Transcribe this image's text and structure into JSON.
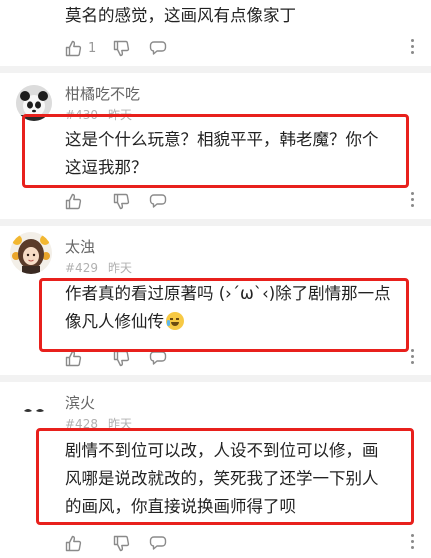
{
  "comments": [
    {
      "lines": [
        "莫名的感觉，这画风有点像家丁"
      ],
      "like_count": "1"
    },
    {
      "username": "柑橘吃不吃",
      "floor": "#430",
      "time": "昨天",
      "lines": [
        "这是个什么玩意？相貌平平，韩老魔？你个",
        "这逗我那？"
      ]
    },
    {
      "username": "太浊",
      "floor": "#429",
      "time": "昨天",
      "lines": [
        "作者真的看过原著吗 (›´ω`‹)除了剧情那一点",
        "像凡人修仙传"
      ]
    },
    {
      "username": "滨火",
      "floor": "#428",
      "time": "昨天",
      "lines": [
        "剧情不到位可以改，人设不到位可以修，画",
        "风哪是说改就改的，笑死我了还学一下别人",
        "的画风，你直接说换画师得了呗"
      ]
    }
  ],
  "icons": {
    "like": "thumbs-up-icon",
    "dislike": "thumbs-down-icon",
    "reply": "comment-bubble-icon",
    "more": "more-vertical-icon",
    "emoji": "laughing-crying-emoji-icon"
  },
  "colors": {
    "highlight": "#e8201c",
    "separator": "#f2f2f2",
    "meta_text": "#b0b0b0"
  }
}
